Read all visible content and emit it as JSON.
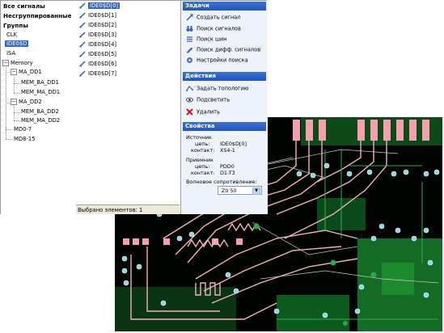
{
  "groups": {
    "all_signals": "Все сигналы",
    "ungrouped": "Несгруппированные",
    "groups": "Группы"
  },
  "tree": {
    "clk": "CLK",
    "ide": "IDE0$D",
    "isa": "ISA",
    "memory": "Memory",
    "ma_dd1": "MA_DD1",
    "mem_ba_dd1": "MEM_BA_DD1",
    "mem_ma_dd1": "MEM_MA_DD1",
    "ma_dd2": "MA_DD2",
    "mem_ba_dd2": "MEM_BA_DD2",
    "mem_ma_dd2": "MEM_MA_DD2",
    "md0_7": "MD0-7",
    "md8_15": "MD8-15"
  },
  "signals": [
    "IDE0$D[0]",
    "IDE0$D[1]",
    "IDE0$D[2]",
    "IDE0$D[3]",
    "IDE0$D[4]",
    "IDE0$D[5]",
    "IDE0$D[6]",
    "IDE0$D[7]"
  ],
  "status": "Выбрано элементов: 1",
  "tasks": {
    "title": "Задачи",
    "items": [
      "Создать сигнал",
      "Поиск сигналов",
      "Поиск шин",
      "Поиск дифф. сигналов",
      "Настройки поиска"
    ]
  },
  "actions": {
    "title": "Действия",
    "items": [
      "Задать топологию",
      "Подсветить",
      "Удалить"
    ]
  },
  "properties": {
    "title": "Свойства",
    "source_label": "Источник",
    "source_net_label": "цепь:",
    "source_net": "IDE0$D[0]",
    "source_contact_label": "контакт:",
    "source_contact": "XS4-1",
    "receiver_label": "Приемник",
    "receiver_net_label": "цепь:",
    "receiver_net": "PDD0",
    "receiver_contact_label": "контакт:",
    "receiver_contact": "D1-T3",
    "impedance_label": "Волновое сопротивление:",
    "impedance_value": "Z0 50"
  },
  "colors": {
    "selection": "#3166c6",
    "section_header": "#2a5fc4",
    "pcb_background": "#000000",
    "pcb_copper": "#1e8a2e",
    "pcb_trace": "#f4b0b8",
    "pcb_via": "#8fd6e0"
  }
}
